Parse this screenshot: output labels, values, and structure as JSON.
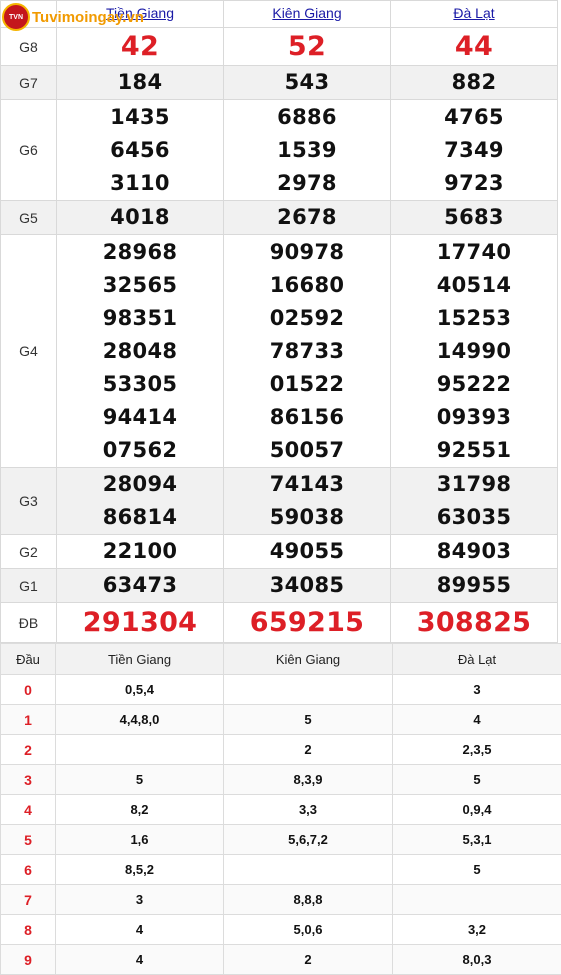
{
  "site": {
    "logo_text": "Tuvimoingay.vn",
    "logo_mark": "TVN"
  },
  "provinces": [
    "Tiền Giang",
    "Kiên Giang",
    "Đà Lạt"
  ],
  "prizes": [
    {
      "label": "G8",
      "values": [
        [
          "42"
        ],
        [
          "52"
        ],
        [
          "44"
        ]
      ]
    },
    {
      "label": "G7",
      "values": [
        [
          "184"
        ],
        [
          "543"
        ],
        [
          "882"
        ]
      ]
    },
    {
      "label": "G6",
      "values": [
        [
          "1435",
          "6456",
          "3110"
        ],
        [
          "6886",
          "1539",
          "2978"
        ],
        [
          "4765",
          "7349",
          "9723"
        ]
      ]
    },
    {
      "label": "G5",
      "values": [
        [
          "4018"
        ],
        [
          "2678"
        ],
        [
          "5683"
        ]
      ]
    },
    {
      "label": "G4",
      "values": [
        [
          "28968",
          "32565",
          "98351",
          "28048",
          "53305",
          "94414",
          "07562"
        ],
        [
          "90978",
          "16680",
          "02592",
          "78733",
          "01522",
          "86156",
          "50057"
        ],
        [
          "17740",
          "40514",
          "15253",
          "14990",
          "95222",
          "09393",
          "92551"
        ]
      ]
    },
    {
      "label": "G3",
      "values": [
        [
          "28094",
          "86814"
        ],
        [
          "74143",
          "59038"
        ],
        [
          "31798",
          "63035"
        ]
      ]
    },
    {
      "label": "G2",
      "values": [
        [
          "22100"
        ],
        [
          "49055"
        ],
        [
          "84903"
        ]
      ]
    },
    {
      "label": "G1",
      "values": [
        [
          "63473"
        ],
        [
          "34085"
        ],
        [
          "89955"
        ]
      ]
    },
    {
      "label": "ĐB",
      "values": [
        [
          "291304"
        ],
        [
          "659215"
        ],
        [
          "308825"
        ]
      ]
    }
  ],
  "loto": {
    "header": {
      "dau": "Đầu",
      "col1": "Tiền Giang",
      "col2": "Kiên Giang",
      "col3": "Đà Lạt"
    },
    "rows": [
      [
        "0",
        "0,5,4",
        "",
        "3"
      ],
      [
        "1",
        "4,4,8,0",
        "5",
        "4"
      ],
      [
        "2",
        "",
        "2",
        "2,3,5"
      ],
      [
        "3",
        "5",
        "8,3,9",
        "5"
      ],
      [
        "4",
        "8,2",
        "3,3",
        "0,9,4"
      ],
      [
        "5",
        "1,6",
        "5,6,7,2",
        "5,3,1"
      ],
      [
        "6",
        "8,5,2",
        "",
        "5"
      ],
      [
        "7",
        "3",
        "8,8,8",
        ""
      ],
      [
        "8",
        "4",
        "5,0,6",
        "3,2"
      ],
      [
        "9",
        "4",
        "2",
        "8,0,3"
      ]
    ]
  },
  "colors": {
    "accent_red": "#dd1f26",
    "link_blue": "#1a1aa6",
    "logo_orange": "#f19a00"
  }
}
